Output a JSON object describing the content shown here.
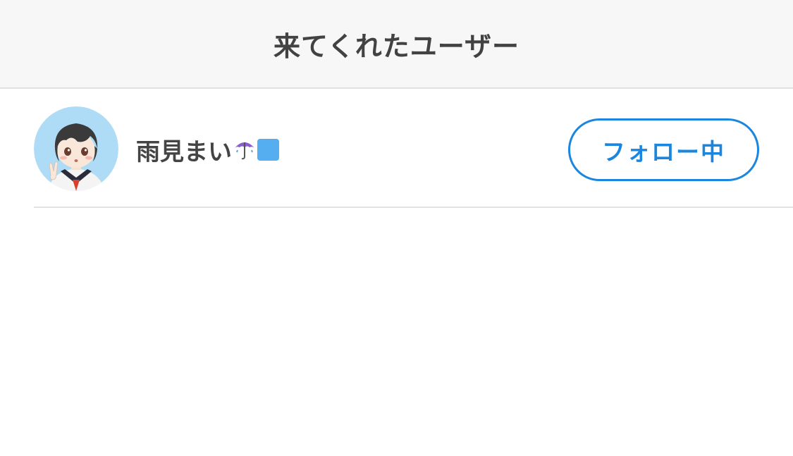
{
  "header": {
    "title": "来てくれたユーザー"
  },
  "users": [
    {
      "name": "雨見まい",
      "emoji": [
        "umbrella-icon",
        "blue-square-icon"
      ],
      "follow_label": "フォロー中"
    }
  ],
  "colors": {
    "accent": "#1a86e0",
    "header_bg": "#f7f7f8",
    "text": "#424242",
    "divider": "#e2e2e4"
  }
}
